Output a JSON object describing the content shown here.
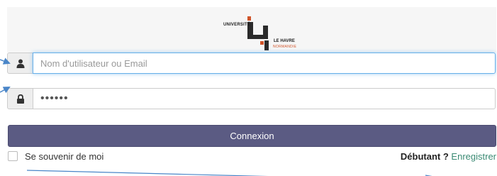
{
  "logo": {
    "line1": "UNIVERSITÉ",
    "line2": "LE HAVRE",
    "line3": "NORMANDIE",
    "colors": {
      "dark": "#2b2b2b",
      "accent": "#d0542a"
    }
  },
  "login": {
    "username_placeholder": "Nom d'utilisateur ou Email",
    "username_value": "",
    "password_value": "••••••",
    "user_icon": "user-icon",
    "lock_icon": "lock-icon",
    "submit_label": "Connexion",
    "remember_label": "Se souvenir de moi",
    "newbie_label": "Débutant ?",
    "register_link": "Enregistrer"
  },
  "annotations": {
    "arrow_color": "#4a86c8",
    "arrows": [
      "arrow-to-username",
      "arrow-to-password",
      "arrow-to-register"
    ]
  },
  "colors": {
    "button": "#5b5b83",
    "link": "#3a8a73",
    "focus_border": "#66afe9"
  }
}
